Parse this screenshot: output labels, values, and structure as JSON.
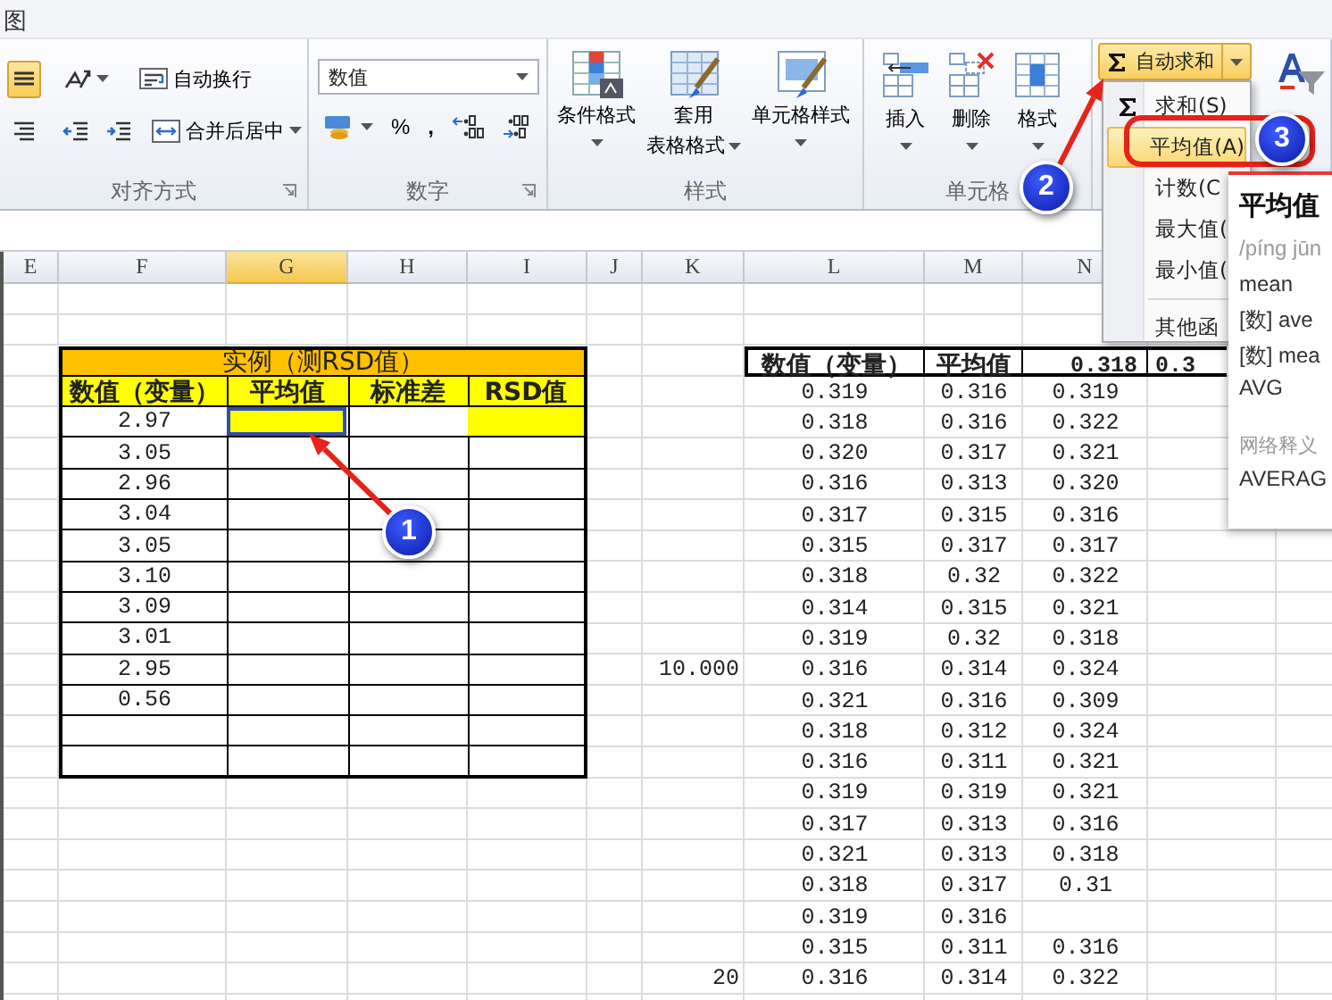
{
  "title_bar": {
    "tab": "图"
  },
  "ribbon": {
    "groups": [
      {
        "kind": "alignment",
        "label": "对齐方式",
        "toggles": [
          {
            "selected": true
          },
          {
            "selected": false
          }
        ],
        "wrap_text": "自动换行",
        "merge_center": "合并后居中"
      },
      {
        "kind": "number",
        "label": "数字",
        "format": "数值",
        "percent": "%",
        "comma": ","
      },
      {
        "kind": "styles",
        "label": "样式",
        "buttons": [
          {
            "lines": [
              "条件格式"
            ]
          },
          {
            "lines": [
              "套用",
              "表格格式"
            ]
          },
          {
            "lines": [
              "单元格样式"
            ]
          }
        ]
      },
      {
        "kind": "cells",
        "label": "单元格",
        "buttons": [
          {
            "label": "插入"
          },
          {
            "label": "删除"
          },
          {
            "label": "格式"
          }
        ]
      },
      {
        "kind": "editing",
        "autosum": {
          "label": "自动求和",
          "open": true
        }
      }
    ]
  },
  "autosum_menu": {
    "items": [
      {
        "kind": "item",
        "label": "求和(S)",
        "icon": true,
        "selected": false
      },
      {
        "kind": "item",
        "label": "平均值(A)",
        "icon": false,
        "selected": true
      },
      {
        "kind": "item",
        "label": "计数(C",
        "icon": false,
        "selected": false
      },
      {
        "kind": "item",
        "label": "最大值(",
        "icon": false,
        "selected": false
      },
      {
        "kind": "item",
        "label": "最小值(",
        "icon": false,
        "selected": false
      },
      {
        "kind": "separator"
      },
      {
        "kind": "item",
        "label": "其他函",
        "icon": false,
        "selected": false
      }
    ],
    "tooltip": {
      "headword": "平均值",
      "pinyin": "/píng jūn",
      "lines": [
        "mean",
        "[数] ave",
        "[数] mea",
        "AVG"
      ],
      "section": "网络释义",
      "web_lines": [
        "AVERAG"
      ]
    }
  },
  "sheet": {
    "columns": [
      {
        "label": "E",
        "selected": false
      },
      {
        "label": "F",
        "selected": false
      },
      {
        "label": "G",
        "selected": true
      },
      {
        "label": "H",
        "selected": false
      },
      {
        "label": "I",
        "selected": false
      },
      {
        "label": "J",
        "selected": false
      },
      {
        "label": "K",
        "selected": false
      },
      {
        "label": "L",
        "selected": false
      },
      {
        "label": "M",
        "selected": false
      },
      {
        "label": "N",
        "selected": false
      }
    ],
    "left_table": {
      "title": "实例（测RSD值）",
      "headers": [
        "数值（变量）",
        "平均值",
        "标准差",
        "RSD值"
      ],
      "rows": [
        {
          "value": "2.97",
          "selected": true,
          "highlighted": true
        },
        {
          "value": "3.05",
          "selected": false,
          "highlighted": false
        },
        {
          "value": "2.96",
          "selected": false,
          "highlighted": false
        },
        {
          "value": "3.04",
          "selected": false,
          "highlighted": false
        },
        {
          "value": "3.05",
          "selected": false,
          "highlighted": false
        },
        {
          "value": "3.10",
          "selected": false,
          "highlighted": false
        },
        {
          "value": "3.09",
          "selected": false,
          "highlighted": false
        },
        {
          "value": "3.01",
          "selected": false,
          "highlighted": false
        },
        {
          "value": "2.95",
          "selected": false,
          "highlighted": false
        },
        {
          "value": "0.56",
          "selected": false,
          "highlighted": false
        },
        {
          "selected": false,
          "highlighted": false
        },
        {
          "selected": false,
          "highlighted": false
        }
      ]
    },
    "right_table": {
      "headers": [
        "数值（变量）",
        "平均值",
        "0.318",
        "0.3"
      ],
      "rows": [
        {
          "l": "0.319",
          "m": "0.316",
          "n": "0.319"
        },
        {
          "l": "0.318",
          "m": "0.316",
          "n": "0.322"
        },
        {
          "l": "0.320",
          "m": "0.317",
          "n": "0.321"
        },
        {
          "l": "0.316",
          "m": "0.313",
          "n": "0.320"
        },
        {
          "l": "0.317",
          "m": "0.315",
          "n": "0.316"
        },
        {
          "l": "0.315",
          "m": "0.317",
          "n": "0.317"
        },
        {
          "l": "0.318",
          "m": "0.32",
          "n": "0.322"
        },
        {
          "l": "0.314",
          "m": "0.315",
          "n": "0.321"
        },
        {
          "l": "0.319",
          "m": "0.32",
          "n": "0.318"
        },
        {
          "k": "10.000",
          "l": "0.316",
          "m": "0.314",
          "n": "0.324"
        },
        {
          "l": "0.321",
          "m": "0.316",
          "n": "0.309"
        },
        {
          "l": "0.318",
          "m": "0.312",
          "n": "0.324"
        },
        {
          "l": "0.316",
          "m": "0.311",
          "n": "0.321"
        },
        {
          "l": "0.319",
          "m": "0.319",
          "n": "0.321"
        },
        {
          "l": "0.317",
          "m": "0.313",
          "n": "0.316"
        },
        {
          "l": "0.321",
          "m": "0.313",
          "n": "0.318"
        },
        {
          "l": "0.318",
          "m": "0.317",
          "n": "0.31"
        },
        {
          "l": "0.319",
          "m": "0.316"
        },
        {
          "l": "0.315",
          "m": "0.311",
          "n": "0.316"
        },
        {
          "k": "20",
          "l": "0.316",
          "m": "0.314",
          "n": "0.322"
        }
      ]
    }
  },
  "annotations": [
    {
      "kind": "arrow",
      "number": "1"
    },
    {
      "kind": "arrow",
      "number": "2"
    },
    {
      "kind": "frame",
      "number": "3"
    }
  ]
}
